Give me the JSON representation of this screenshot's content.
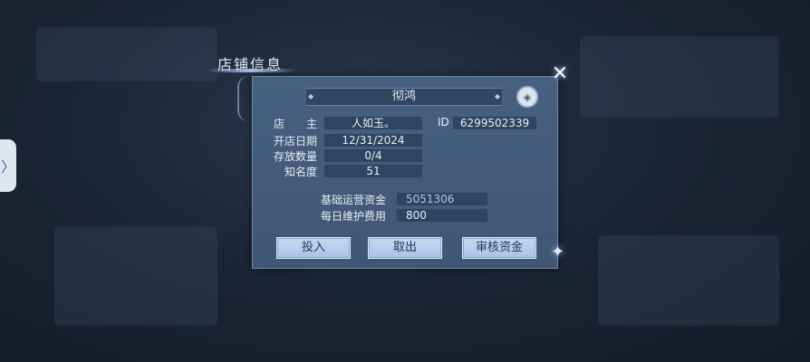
{
  "window": {
    "title": "店铺信息"
  },
  "shop": {
    "name": "彻鸿",
    "owner_label": "店　　主",
    "owner_value": "人如玉。",
    "id_label": "ID",
    "id_value": "6299502339",
    "open_date_label": "开店日期",
    "open_date_value": "12/31/2024",
    "storage_label": "存放数量",
    "storage_value": "0/4",
    "fame_label": "知名度",
    "fame_value": "51",
    "base_funds_label": "基础运营资金",
    "base_funds_value": "5051306",
    "daily_fee_label": "每日维护费用",
    "daily_fee_value": "800"
  },
  "buttons": {
    "invest": "投入",
    "withdraw": "取出",
    "audit": "审核资金"
  },
  "side_handle": {
    "glyph": "〉"
  },
  "close": {
    "glyph": "✕"
  },
  "emblem": {
    "icon": "shop-emblem-icon",
    "glyph": "◈"
  },
  "colors": {
    "panel": "#48607f",
    "field": "#2e4461",
    "button": "#b8cde9",
    "text": "#e8eef6"
  }
}
